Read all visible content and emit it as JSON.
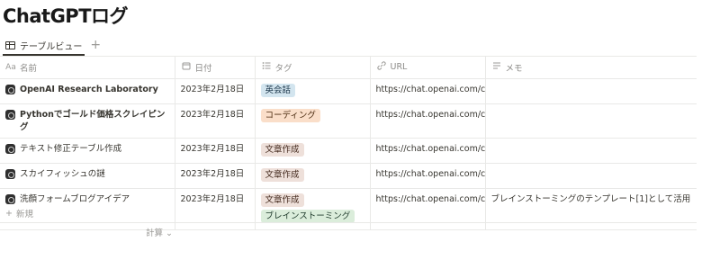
{
  "page": {
    "title": "ChatGPTログ"
  },
  "view": {
    "tab_label": "テーブルビュー",
    "add_label": "+"
  },
  "columns": {
    "name": {
      "icon": "Aa",
      "label": "名前"
    },
    "date": {
      "icon": "calendar-icon",
      "label": "日付"
    },
    "tag": {
      "icon": "list-icon",
      "label": "タグ"
    },
    "url": {
      "icon": "link-icon",
      "label": "URL"
    },
    "memo": {
      "icon": "text-lines-icon",
      "label": "メモ"
    }
  },
  "rows": [
    {
      "name": "OpenAI Research Laboratory",
      "date": "2023年2月18日",
      "tags": [
        "英会話"
      ],
      "url": "https://chat.openai.com/chat",
      "memo": ""
    },
    {
      "name": "Pythonでゴールド価格スクレイピング",
      "date": "2023年2月18日",
      "tags": [
        "コーディング"
      ],
      "url": "https://chat.openai.com/chat",
      "memo": ""
    },
    {
      "name": "テキスト修正テーブル作成",
      "date": "2023年2月18日",
      "tags": [
        "文章作成"
      ],
      "url": "https://chat.openai.com/chat",
      "memo": ""
    },
    {
      "name": "スカイフィッシュの謎",
      "date": "2023年2月18日",
      "tags": [
        "文章作成"
      ],
      "url": "https://chat.openai.com/chat",
      "memo": ""
    },
    {
      "name": "洗顔フォームブログアイデア",
      "date": "2023年2月18日",
      "tags": [
        "文章作成",
        "ブレインストーミング"
      ],
      "url": "https://chat.openai.com/chat",
      "memo": "ブレインストーミングのテンプレート[1]として活用"
    }
  ],
  "tag_colors": {
    "英会話": "#d3e5ef",
    "コーディング": "#fadec9",
    "文章作成": "#eee0da",
    "ブレインストーミング": "#dbeddb"
  },
  "footer": {
    "new_label": "新規",
    "calc_label": "計算"
  }
}
